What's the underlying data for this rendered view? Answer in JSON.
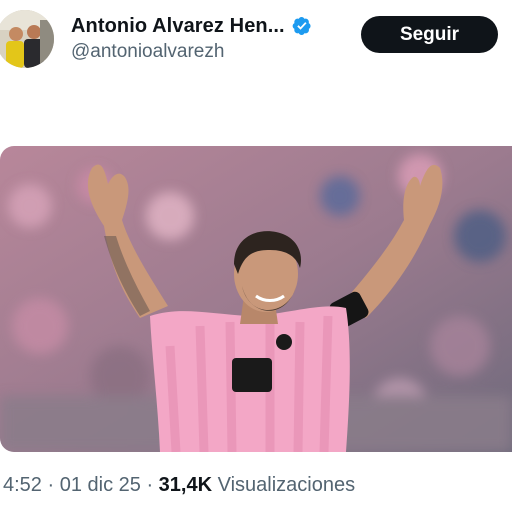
{
  "author": {
    "display_name": "Antonio Alvarez Hen...",
    "handle": "@antonioalvarezh",
    "verified": true,
    "avatar_icon": "profile-photo"
  },
  "actions": {
    "follow_label": "Seguir"
  },
  "post": {
    "media_description_icon": "photo-soccer-player-celebrating",
    "time": "4:52",
    "separator": " · ",
    "date": "01 dic 25",
    "views_count": "31,4K",
    "views_label": "Visualizaciones"
  },
  "colors": {
    "text_primary": "#0f1419",
    "text_secondary": "#536471",
    "verified_blue": "#1d9bf0",
    "button_bg": "#0f1419",
    "jersey_pink": "#f3a7c6"
  }
}
